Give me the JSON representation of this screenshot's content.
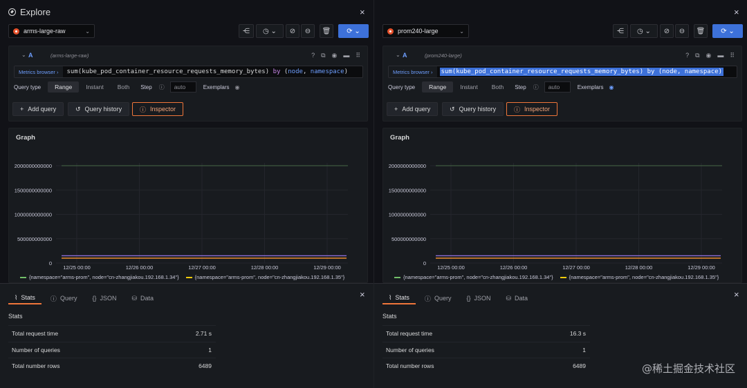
{
  "app": {
    "title": "Explore"
  },
  "icons": {
    "close": "×",
    "share": "share-icon",
    "history": "clock-icon",
    "link": "link-icon",
    "zoom_out": "zoom-out-icon",
    "trash": "trash-icon",
    "refresh": "refresh-icon"
  },
  "colors": {
    "accent": "#3d71d9",
    "inspector": "#f0763a",
    "series_green": "#73bf69",
    "series_yellow": "#f2cc0c",
    "series_purple": "#8f6fd8",
    "series_orange": "#ff9830"
  },
  "left": {
    "datasource": "arms-large-raw",
    "query_letter": "A",
    "query_ds": "(arms-large-raw)",
    "metrics_browser": "Metrics browser ›",
    "expr_parts": {
      "p1": "sum(",
      "metric": "kube_pod_container_resource_requests_memory_bytes",
      "p2": ") ",
      "by": "by",
      "p3": " (",
      "l1": "node",
      "p4": ", ",
      "l2": "namespace",
      "p5": ")"
    },
    "query_type_label": "Query type",
    "query_types": [
      "Range",
      "Instant",
      "Both"
    ],
    "step_label": "Step",
    "step_placeholder": "auto",
    "exemplars_label": "Exemplars",
    "buttons": {
      "add_query": "Add query",
      "query_history": "Query history",
      "inspector": "Inspector"
    },
    "graph_title": "Graph",
    "legend": [
      {
        "label": "{namespace=\"arms-prom\", node=\"cn-zhangjiakou.192.168.1.34\"}"
      },
      {
        "label": "{namespace=\"arms-prom\", node=\"cn-zhangjiakou.192.168.1.35\"}"
      }
    ],
    "inspector_tabs": [
      "Stats",
      "Query",
      "JSON",
      "Data"
    ],
    "stats_heading": "Stats",
    "stats": [
      {
        "label": "Total request time",
        "value": "2.71 s"
      },
      {
        "label": "Number of queries",
        "value": "1"
      },
      {
        "label": "Total number rows",
        "value": "6489"
      }
    ]
  },
  "right": {
    "datasource": "prom240-large",
    "query_letter": "A",
    "query_ds": "(prom240-large)",
    "metrics_browser": "Metrics browser ›",
    "expr_parts": {
      "p1": "sum(",
      "metric": "kube_pod_container_resource_requests_memory_bytes",
      "p2": ") ",
      "by": "by",
      "p3": " (",
      "l1": "node",
      "p4": ", ",
      "l2": "namespace",
      "p5": ")"
    },
    "query_type_label": "Query type",
    "query_types": [
      "Range",
      "Instant",
      "Both"
    ],
    "step_label": "Step",
    "step_placeholder": "auto",
    "exemplars_label": "Exemplars",
    "buttons": {
      "add_query": "Add query",
      "query_history": "Query history",
      "inspector": "Inspector"
    },
    "graph_title": "Graph",
    "legend": [
      {
        "label": "{namespace=\"arms-prom\", node=\"cn-zhangjiakou.192.168.1.34\"}"
      },
      {
        "label": "{namespace=\"arms-prom\", node=\"cn-zhangjiakou.192.168.1.35\"}"
      }
    ],
    "inspector_tabs": [
      "Stats",
      "Query",
      "JSON",
      "Data"
    ],
    "stats_heading": "Stats",
    "stats": [
      {
        "label": "Total request time",
        "value": "16.3 s"
      },
      {
        "label": "Number of queries",
        "value": "1"
      },
      {
        "label": "Total number rows",
        "value": "6489"
      }
    ]
  },
  "chart_data": [
    {
      "type": "line",
      "title": "Graph",
      "x": [
        "12/25 00:00",
        "12/26 00:00",
        "12/27 00:00",
        "12/28 00:00",
        "12/29 00:00"
      ],
      "yticks": [
        "0",
        "500000000000",
        "1000000000000",
        "1500000000000",
        "2000000000000"
      ],
      "ylim": [
        0,
        2000000000000
      ],
      "series": [
        {
          "name": "{namespace=\"arms-prom\", node=\"cn-zhangjiakou.192.168.1.34\"}",
          "values": [
            150000000000,
            150000000000,
            150000000000,
            150000000000,
            150000000000
          ]
        },
        {
          "name": "{namespace=\"arms-prom\", node=\"cn-zhangjiakou.192.168.1.35\"}",
          "values": [
            100000000000,
            100000000000,
            100000000000,
            100000000000,
            100000000000
          ]
        }
      ]
    },
    {
      "type": "line",
      "title": "Graph",
      "x": [
        "12/25 00:00",
        "12/26 00:00",
        "12/27 00:00",
        "12/28 00:00",
        "12/29 00:00"
      ],
      "yticks": [
        "0",
        "500000000000",
        "1000000000000",
        "1500000000000",
        "2000000000000"
      ],
      "ylim": [
        0,
        2000000000000
      ],
      "series": [
        {
          "name": "{namespace=\"arms-prom\", node=\"cn-zhangjiakou.192.168.1.34\"}",
          "values": [
            150000000000,
            150000000000,
            150000000000,
            150000000000,
            150000000000
          ]
        },
        {
          "name": "{namespace=\"arms-prom\", node=\"cn-zhangjiakou.192.168.1.35\"}",
          "values": [
            100000000000,
            100000000000,
            100000000000,
            100000000000,
            100000000000
          ]
        }
      ]
    }
  ],
  "watermark": "@稀土掘金技术社区"
}
